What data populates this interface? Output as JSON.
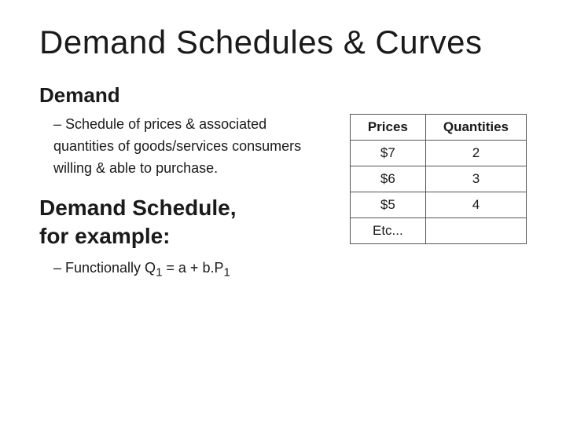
{
  "slide": {
    "title": "Demand Schedules & Curves",
    "section_label": "Demand",
    "bullet": "– Schedule of prices & associated quantities of goods/services consumers willing & able to purchase.",
    "demand_schedule_line1": "Demand Schedule,",
    "demand_schedule_line2": "for example:",
    "functionally": "– Functionally   Q",
    "formula_sub": "1",
    "formula_rest": " = a + b.P",
    "formula_sub2": "1",
    "table": {
      "col1_header": "Prices",
      "col2_header": "Quantities",
      "rows": [
        {
          "price": "$7",
          "quantity": "2"
        },
        {
          "price": "$6",
          "quantity": "3"
        },
        {
          "price": "$5",
          "quantity": "4"
        },
        {
          "price": "Etc...",
          "quantity": ""
        }
      ]
    }
  }
}
